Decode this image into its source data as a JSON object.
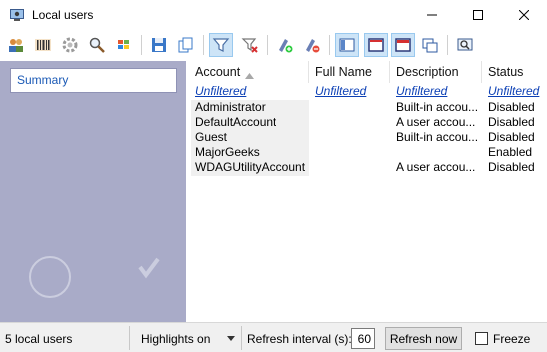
{
  "window": {
    "title": "Local users"
  },
  "toolbar": {
    "icons": [
      "users-icon",
      "barcode-icon",
      "gear-icon",
      "search-user-icon",
      "windows-icon",
      "save-icon",
      "copy-icon",
      "filter-icon",
      "clear-filter-icon",
      "add-user-icon",
      "remove-user-icon",
      "layout-panel-icon",
      "window-red-icon",
      "window-frame-icon",
      "windows-stack-icon",
      "screen-search-icon"
    ]
  },
  "sidebar": {
    "summary_label": "Summary"
  },
  "table": {
    "columns": [
      "Account",
      "Full Name",
      "Description",
      "Status"
    ],
    "filter_label": "Unfiltered",
    "rows": [
      {
        "account": "Administrator",
        "full_name": "",
        "description": "Built-in accou...",
        "status": "Disabled"
      },
      {
        "account": "DefaultAccount",
        "full_name": "",
        "description": "A user accou...",
        "status": "Disabled"
      },
      {
        "account": "Guest",
        "full_name": "",
        "description": "Built-in accou...",
        "status": "Disabled"
      },
      {
        "account": "MajorGeeks",
        "full_name": "",
        "description": "",
        "status": "Enabled"
      },
      {
        "account": "WDAGUtilityAccount",
        "full_name": "",
        "description": "A user accou...",
        "status": "Disabled"
      }
    ]
  },
  "statusbar": {
    "count_text": "5 local users",
    "highlights_label": "Highlights on",
    "refresh_interval_label": "Refresh interval (s):",
    "refresh_interval_value": "60",
    "refresh_now_label": "Refresh now",
    "freeze_label": "Freeze"
  }
}
